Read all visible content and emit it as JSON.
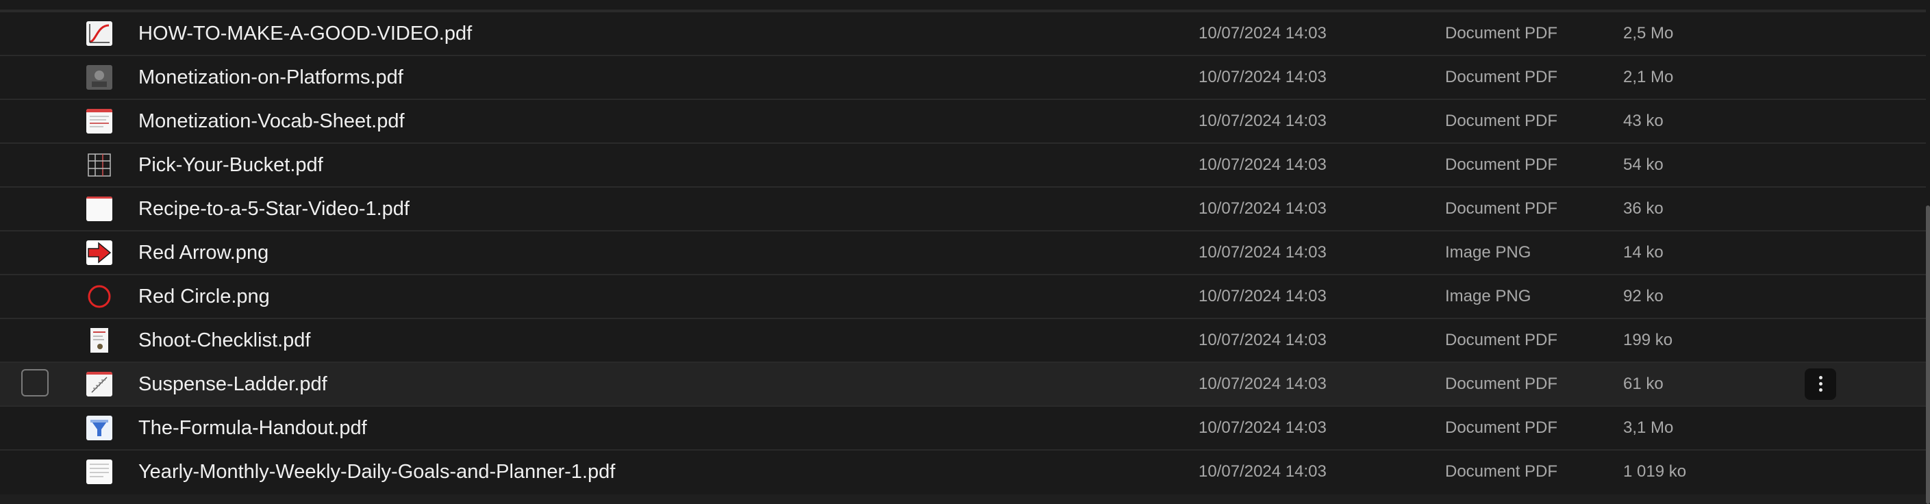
{
  "files": [
    {
      "name": "HOW-TO-MAKE-A-GOOD-VIDEO.pdf",
      "date": "10/07/2024 14:03",
      "kind": "Document PDF",
      "size": "2,5 Mo",
      "icon": "pdf-red-graph-icon"
    },
    {
      "name": "Monetization-on-Platforms.pdf",
      "date": "10/07/2024 14:03",
      "kind": "Document PDF",
      "size": "2,1 Mo",
      "icon": "pdf-dark-photo-icon"
    },
    {
      "name": "Monetization-Vocab-Sheet.pdf",
      "date": "10/07/2024 14:03",
      "kind": "Document PDF",
      "size": "43 ko",
      "icon": "pdf-document-icon"
    },
    {
      "name": "Pick-Your-Bucket.pdf",
      "date": "10/07/2024 14:03",
      "kind": "Document PDF",
      "size": "54 ko",
      "icon": "pdf-table-icon"
    },
    {
      "name": "Recipe-to-a-5-Star-Video-1.pdf",
      "date": "10/07/2024 14:03",
      "kind": "Document PDF",
      "size": "36 ko",
      "icon": "pdf-blank-page-icon"
    },
    {
      "name": "Red Arrow.png",
      "date": "10/07/2024 14:03",
      "kind": "Image PNG",
      "size": "14 ko",
      "icon": "red-arrow-image-icon"
    },
    {
      "name": "Red Circle.png",
      "date": "10/07/2024 14:03",
      "kind": "Image PNG",
      "size": "92 ko",
      "icon": "red-circle-image-icon"
    },
    {
      "name": "Shoot-Checklist.pdf",
      "date": "10/07/2024 14:03",
      "kind": "Document PDF",
      "size": "199 ko",
      "icon": "pdf-checklist-icon"
    },
    {
      "name": "Suspense-Ladder.pdf",
      "date": "10/07/2024 14:03",
      "kind": "Document PDF",
      "size": "61 ko",
      "icon": "pdf-ladder-icon"
    },
    {
      "name": "The-Formula-Handout.pdf",
      "date": "10/07/2024 14:03",
      "kind": "Document PDF",
      "size": "3,1 Mo",
      "icon": "pdf-funnel-icon"
    },
    {
      "name": "Yearly-Monthly-Weekly-Daily-Goals-and-Planner-1.pdf",
      "date": "10/07/2024 14:03",
      "kind": "Document PDF",
      "size": "1 019 ko",
      "icon": "pdf-planner-icon"
    }
  ],
  "hovered_row": 8,
  "colors": {
    "background": "#1a1a1a",
    "row_hover": "#242424",
    "divider": "#2a2a2a",
    "name_text": "#f0f0f0",
    "meta_text": "#a9a9a9",
    "accent_red": "#e02424"
  }
}
